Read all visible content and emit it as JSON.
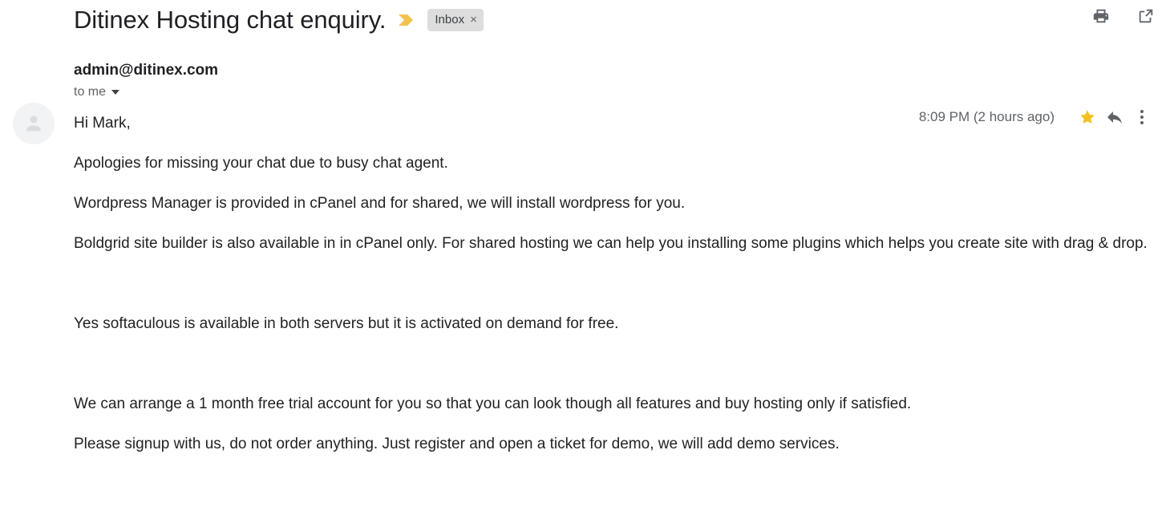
{
  "header": {
    "subject": "Ditinex Hosting chat enquiry.",
    "important_marker_icon": "double-chevron-important-icon",
    "label": {
      "text": "Inbox",
      "close_glyph": "×"
    },
    "actions": [
      {
        "name": "print-icon",
        "tooltip": "Print all"
      },
      {
        "name": "open-in-new-window-icon",
        "tooltip": "In new window"
      }
    ]
  },
  "message": {
    "avatar_icon": "default-user-avatar-icon",
    "sender": "admin@ditinex.com",
    "recipient": "to me",
    "timestamp": "8:09 PM (2 hours ago)",
    "star_icon": "star-filled-icon",
    "reply_icon": "reply-arrow-icon",
    "more_icon": "more-vertical-icon",
    "body": [
      "Hi Mark,",
      "Apologies for missing your chat due to busy chat agent.",
      "Wordpress Manager is provided in cPanel and for shared, we will install wordpress for you.",
      "Boldgrid site builder is also available in in cPanel only. For shared hosting we can help you installing some plugins which helps you create site with drag & drop.",
      "",
      "Yes softaculous is available in both servers but it is activated on demand for free.",
      "",
      "We can arrange a 1 month free trial account for you so that you can look though all features and buy hosting only if satisfied.",
      "Please signup with us, do not order anything. Just register and open a ticket for demo, we will add demo services."
    ]
  },
  "colors": {
    "star": "#f4c01f",
    "important_marker": "#f2c14e",
    "label_chip_bg": "#dddddd",
    "text_primary": "#202124",
    "text_secondary": "#5f6368",
    "icon": "#5f6368"
  }
}
